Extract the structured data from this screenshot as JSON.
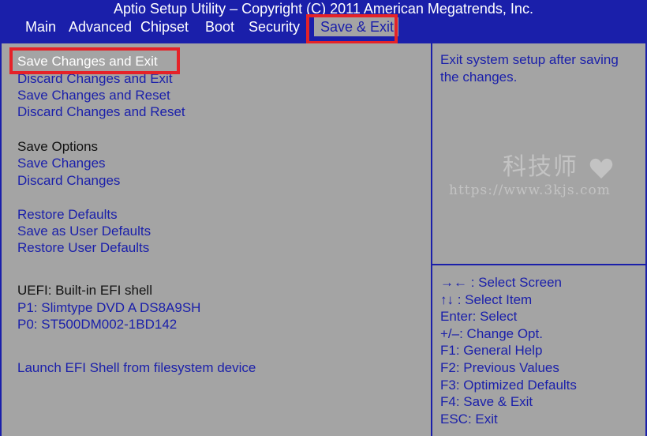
{
  "header": {
    "title": "Aptio Setup Utility – Copyright (C) 2011 American Megatrends, Inc."
  },
  "tabs": [
    {
      "label": "Main"
    },
    {
      "label": "Advanced"
    },
    {
      "label": "Chipset"
    },
    {
      "label": "Boot"
    },
    {
      "label": "Security"
    },
    {
      "label": "Save & Exit",
      "active": true
    }
  ],
  "menu": {
    "save_changes_and_exit": "Save Changes and Exit",
    "discard_changes_and_exit": "Discard Changes and Exit",
    "save_changes_and_reset": "Save Changes and Reset",
    "discard_changes_and_reset": "Discard Changes and Reset",
    "save_options_label": "Save Options",
    "save_changes": "Save Changes",
    "discard_changes": "Discard Changes",
    "restore_defaults": "Restore Defaults",
    "save_as_user_defaults": "Save as User Defaults",
    "restore_user_defaults": "Restore User Defaults",
    "boot_override": [
      "UEFI: Built-in EFI shell",
      "P1: Slimtype DVD A DS8A9SH",
      "P0: ST500DM002-1BD142"
    ],
    "launch_efi_shell": "Launch EFI Shell from filesystem device"
  },
  "help": {
    "text": "Exit system setup after saving the changes."
  },
  "keys": [
    "→← : Select Screen",
    "↑↓ : Select Item",
    "Enter: Select",
    "+/–: Change Opt.",
    "F1: General Help",
    "F2: Previous Values",
    "F3: Optimized Defaults",
    "F4: Save & Exit",
    "ESC: Exit"
  ],
  "watermark": {
    "name": "科技师",
    "url": "https://www.3kjs.com"
  },
  "colors": {
    "frame_blue": "#1a1faa",
    "panel_gray": "#a4a4a4",
    "highlight_red": "#e52228",
    "selected_text": "#ffffff"
  }
}
